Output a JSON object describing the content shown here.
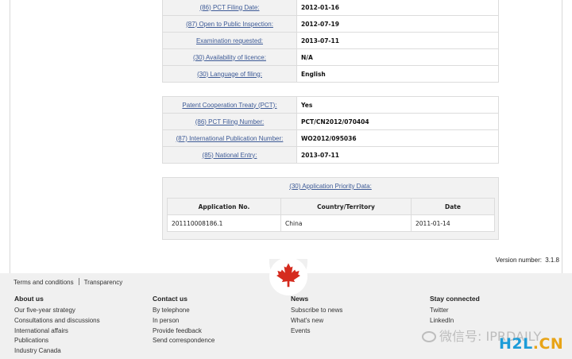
{
  "details_1": [
    {
      "label": "(86) PCT Filing Date:",
      "value": "2012-01-16"
    },
    {
      "label": "(87) Open to Public Inspection:",
      "value": "2012-07-19"
    },
    {
      "label": "Examination requested:",
      "value": "2013-07-11"
    },
    {
      "label": "(30) Availability of licence:",
      "value": "N/A"
    },
    {
      "label": "(30) Language of filing:",
      "value": "English"
    }
  ],
  "details_2": [
    {
      "label": "Patent Cooperation Treaty (PCT):",
      "value": "Yes"
    },
    {
      "label": "(86) PCT Filing Number:",
      "value": "PCT/CN2012/070404"
    },
    {
      "label": "(87) International Publication Number:",
      "value": "WO2012/095036"
    },
    {
      "label": "(85) National Entry:",
      "value": "2013-07-11"
    }
  ],
  "priority": {
    "title": "(30) Application Priority Data:",
    "headers": [
      "Application No.",
      "Country/Territory",
      "Date"
    ],
    "rows": [
      [
        "201110008186.1",
        "China",
        "2011-01-14"
      ]
    ]
  },
  "version": {
    "label": "Version number:",
    "value": "3.1.8"
  },
  "footer": {
    "top_links": [
      "Terms and conditions",
      "Transparency"
    ],
    "columns": [
      {
        "heading": "About us",
        "links": [
          "Our five-year strategy",
          "Consultations and discussions",
          "International affairs",
          "Publications",
          "Industry Canada"
        ]
      },
      {
        "heading": "Contact us",
        "links": [
          "By telephone",
          "In person",
          "Provide feedback",
          "Send correspondence"
        ]
      },
      {
        "heading": "News",
        "links": [
          "Subscribe to news",
          "What's new",
          "Events"
        ]
      },
      {
        "heading": "Stay connected",
        "links": [
          "Twitter",
          "LinkedIn"
        ]
      }
    ],
    "leaf_icon": "maple-leaf-icon",
    "leaf_color": "#d52b1e"
  },
  "watermark": {
    "text": "微信号: IPRDAILY",
    "brand_a": "H2L",
    "brand_b": ".CN"
  }
}
